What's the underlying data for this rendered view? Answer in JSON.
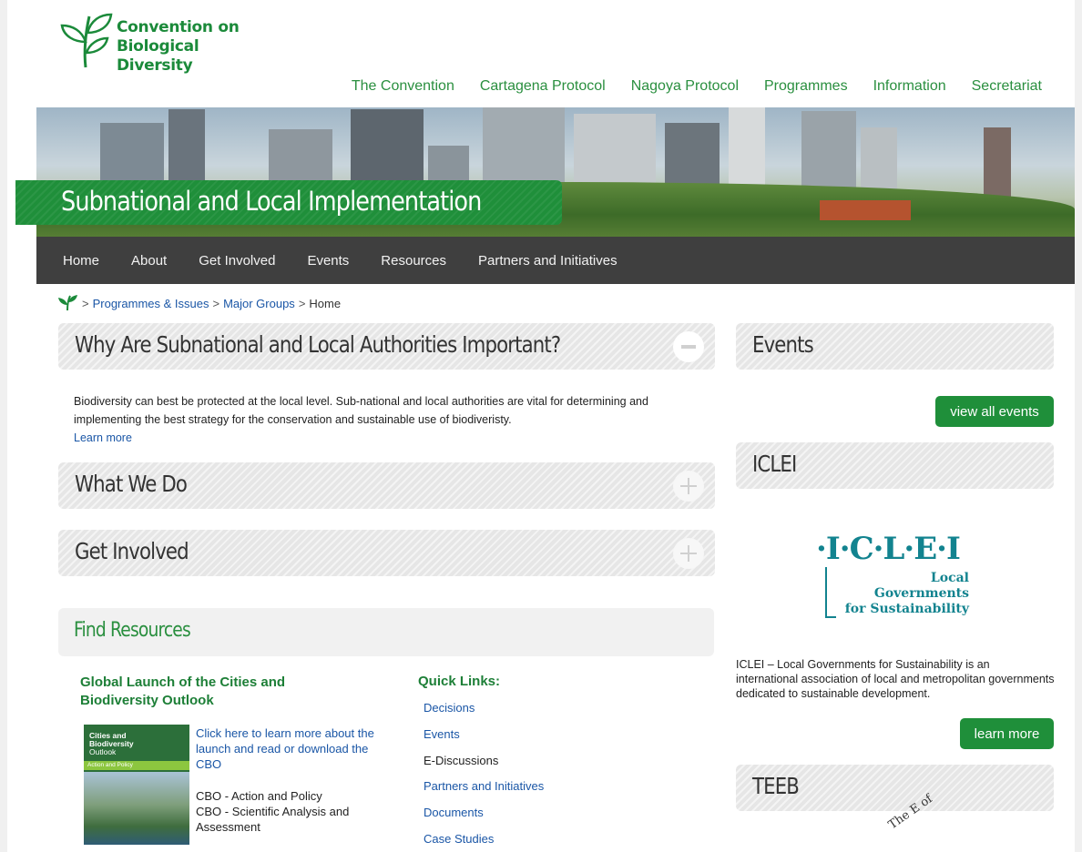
{
  "header": {
    "logo_line1": "Convention on",
    "logo_line2": "Biological Diversity",
    "nav": [
      "The Convention",
      "Cartagena Protocol",
      "Nagoya Protocol",
      "Programmes",
      "Information",
      "Secretariat"
    ]
  },
  "banner": {
    "title": "Subnational and Local Implementation"
  },
  "subnav": [
    "Home",
    "About",
    "Get Involved",
    "Events",
    "Resources",
    "Partners and Initiatives"
  ],
  "breadcrumb": {
    "items": [
      "Programmes & Issues",
      "Major Groups"
    ],
    "current": "Home",
    "separator": ">"
  },
  "main": {
    "panel1_title": "Why Are Subnational and Local Authorities Important?",
    "intro_text": "Biodiversity can best be protected at the local level. Sub-national and local authorities are vital for determining and implementing the best strategy for the conservation and sustainable use of biodiveristy.",
    "learn_more": "Learn more",
    "panel2_title": "What We Do",
    "panel3_title": "Get Involved",
    "find_title": "Find Resources",
    "cbo": {
      "title": "Global Launch of the Cities and Biodiversity Outlook",
      "cover_line1": "Cities and",
      "cover_line2": "Biodiversity",
      "cover_line3": "Outlook",
      "cover_line4": "Action and Policy",
      "link": "Click here to learn more about the launch and read or download the CBO",
      "item1": "CBO - Action and Policy",
      "item2": "CBO - Scientific Analysis and Assessment"
    },
    "quick_links": {
      "title": "Quick Links:",
      "items": [
        "Decisions",
        "Events",
        "E-Discussions",
        "Partners and Initiatives",
        "Documents",
        "Case Studies"
      ]
    }
  },
  "sidebar": {
    "events_title": "Events",
    "view_all_events": "view all events",
    "iclei_title": "ICLEI",
    "iclei_logo_letters": "·I·C·L·E·I",
    "iclei_logo_sub1": "Local",
    "iclei_logo_sub2": "Governments",
    "iclei_logo_sub3": "for Sustainability",
    "iclei_desc": "ICLEI – Local Governments for Sustainability is an international association of local and metropolitan governments dedicated to sustainable development.",
    "learn_more": "learn more",
    "teeb_title": "TEEB",
    "teeb_art": "The E of"
  },
  "colors": {
    "brand_green": "#1f8f3a",
    "nav_dark": "#3f3f3f",
    "link_blue": "#1a56a6",
    "iclei_teal": "#12838f"
  }
}
